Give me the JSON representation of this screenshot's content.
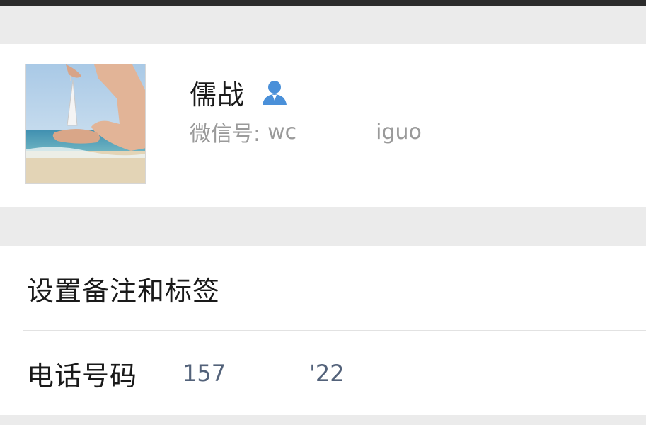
{
  "profile": {
    "name": "儒战",
    "wechat_id_label": "微信号:",
    "wechat_id_prefix": "wc",
    "wechat_id_suffix": "iguo",
    "icon": "contact-person-icon",
    "icon_color": "#4a90d9"
  },
  "settings": {
    "remark_tags_label": "设置备注和标签",
    "phone_label": "电话号码",
    "phone_prefix": "157",
    "phone_suffix": "'22"
  }
}
